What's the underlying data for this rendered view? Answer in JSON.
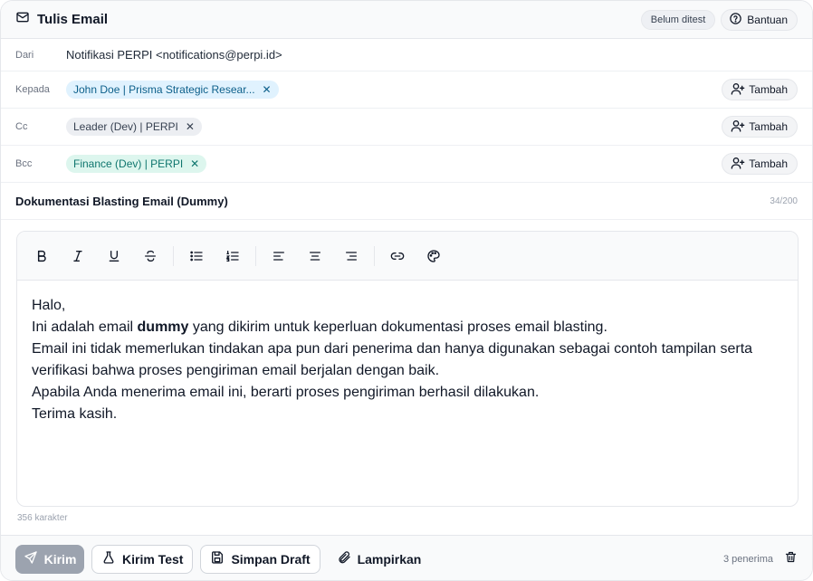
{
  "header": {
    "title": "Tulis Email",
    "status_badge": "Belum ditest",
    "help_label": "Bantuan"
  },
  "fields": {
    "from": {
      "label": "Dari",
      "value": "Notifikasi PERPI <notifications@perpi.id>"
    },
    "to": {
      "label": "Kepada",
      "chips": [
        "John Doe | Prisma Strategic Resear..."
      ],
      "add_label": "Tambah"
    },
    "cc": {
      "label": "Cc",
      "chips": [
        "Leader (Dev) | PERPI"
      ],
      "add_label": "Tambah"
    },
    "bcc": {
      "label": "Bcc",
      "chips": [
        "Finance (Dev) | PERPI"
      ],
      "add_label": "Tambah"
    }
  },
  "subject": {
    "value": "Dokumentasi Blasting Email (Dummy)",
    "counter": "34/200"
  },
  "toolbar": {
    "buttons": [
      "bold",
      "italic",
      "underline",
      "strikethrough",
      "bullet-list",
      "numbered-list",
      "align-left",
      "align-center",
      "align-right",
      "link",
      "color-palette"
    ]
  },
  "body": {
    "line1": "Halo,",
    "line2_before": "Ini adalah email ",
    "line2_bold": "dummy",
    "line2_after": " yang dikirim untuk keperluan dokumentasi proses email blasting.",
    "line3": "Email ini tidak memerlukan tindakan apa pun dari penerima dan hanya digunakan sebagai contoh tampilan serta verifikasi bahwa proses pengiriman email berjalan dengan baik.",
    "line4": "Apabila Anda menerima email ini, berarti proses pengiriman berhasil dilakukan.",
    "line5": "Terima kasih."
  },
  "char_count": "356 karakter",
  "footer": {
    "send_label": "Kirim",
    "send_test_label": "Kirim Test",
    "save_draft_label": "Simpan Draft",
    "attach_label": "Lampirkan",
    "recipients": "3 penerima"
  },
  "colors": {
    "chip_to_bg": "#e0f2fe",
    "chip_cc_bg": "#eceef2",
    "chip_bcc_bg": "#ddf6ee",
    "send_button_disabled": "#9ca3af"
  }
}
